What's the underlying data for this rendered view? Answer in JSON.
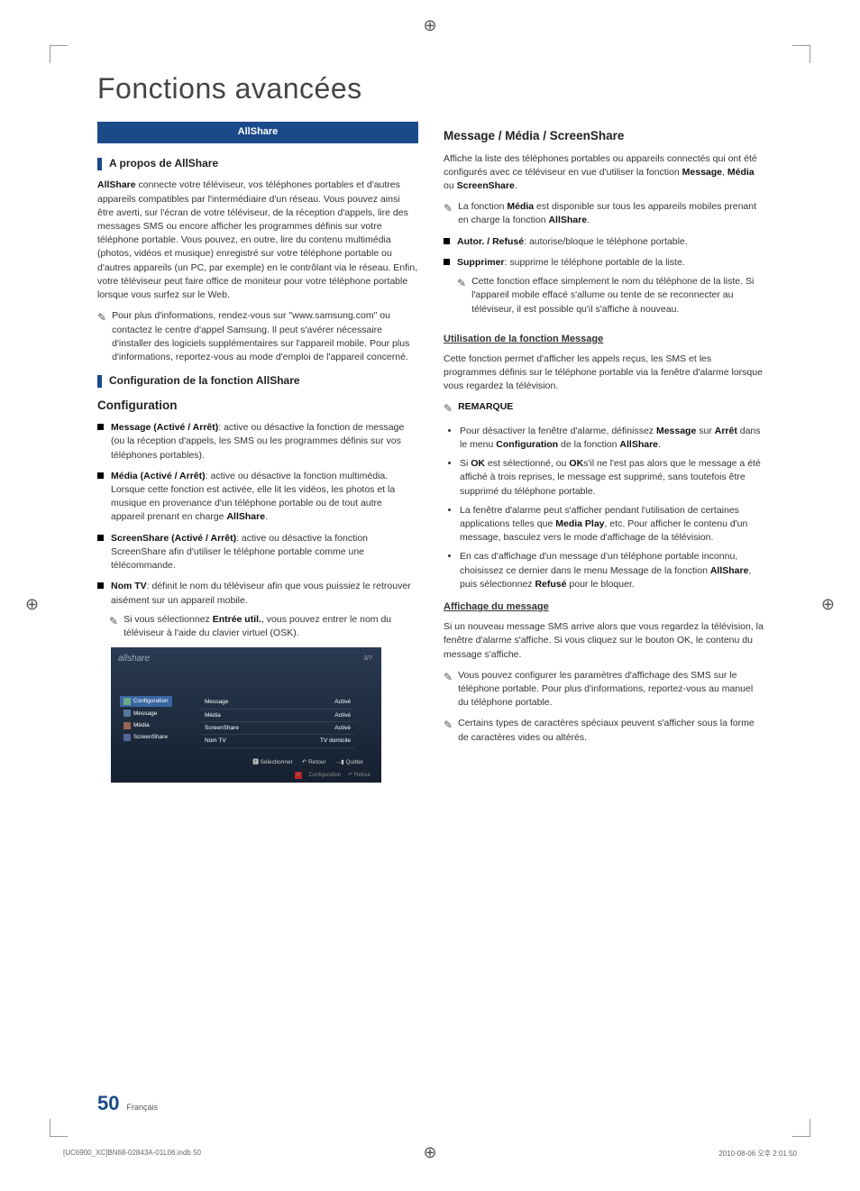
{
  "page_title": "Fonctions avancées",
  "tab_label": "AllShare",
  "left": {
    "section1_title": "A propos de AllShare",
    "para1_a": "AllShare",
    "para1_b": " connecte votre téléviseur, vos téléphones portables et d'autres appareils compatibles par l'intermédiaire d'un réseau. Vous pouvez ainsi être averti, sur l'écran de votre téléviseur, de la réception d'appels, lire des messages SMS ou encore afficher les programmes définis sur votre téléphone portable. Vous pouvez, en outre, lire du contenu multimédia (photos, vidéos et musique) enregistré sur votre téléphone portable ou d'autres appareils (un PC, par exemple) en le contrôlant via le réseau. Enfin, votre téléviseur peut faire office de moniteur pour votre téléphone portable lorsque vous surfez sur le Web.",
    "note1": "Pour plus d'informations, rendez-vous sur \"www.samsung.com\" ou contactez le centre d'appel Samsung. Il peut s'avérer nécessaire d'installer des logiciels supplémentaires sur l'appareil mobile. Pour plus d'informations, reportez-vous au mode d'emploi de l'appareil concerné.",
    "section2_title": "Configuration de la fonction AllShare",
    "config_heading": "Configuration",
    "bullets": [
      {
        "b": "Message (Activé / Arrêt)",
        "t": ": active ou désactive la fonction de message (ou la réception d'appels, les SMS ou les programmes définis sur vos téléphones portables)."
      },
      {
        "b": "Média (Activé / Arrêt)",
        "t": ": active ou désactive la fonction multimédia. Lorsque cette fonction est activée, elle lit les vidéos, les photos et la musique en provenance d'un téléphone portable ou de tout autre appareil prenant en charge ",
        "b2": "AllShare",
        "t2": "."
      },
      {
        "b": "ScreenShare (Activé / Arrêt)",
        "t": ": active ou désactive la fonction ScreenShare afin d'utiliser le téléphone portable comme une télécommande."
      },
      {
        "b": "Nom TV",
        "t": ": définit le nom du téléviseur afin que vous puissiez le retrouver aisément sur un appareil mobile."
      }
    ],
    "nomtv_note_pre": "Si vous sélectionnez ",
    "nomtv_note_b": "Entrée util.",
    "nomtv_note_post": ", vous pouvez entrer le nom du téléviseur à l'aide du clavier virtuel (OSK).",
    "screenshot": {
      "logo": "allshare",
      "badge": "3/7",
      "menu": [
        {
          "label": "Configuration",
          "active": true
        },
        {
          "label": "Message",
          "active": false
        },
        {
          "label": "Média",
          "active": false
        },
        {
          "label": "ScreenShare",
          "active": false
        }
      ],
      "rows": [
        {
          "k": "Message",
          "v": "Activé"
        },
        {
          "k": "Média",
          "v": "Activé"
        },
        {
          "k": "ScreenShare",
          "v": "Activé"
        },
        {
          "k": "Nom TV",
          "v": "TV domicile"
        }
      ],
      "footer": {
        "select": "Sélectionner",
        "return": "Retour",
        "exit": "Quitter"
      },
      "footer2": {
        "a": "Configuration",
        "b": "Retour"
      }
    }
  },
  "right": {
    "heading": "Message / Média / ScreenShare",
    "intro_a": "Affiche la liste des téléphones portables ou appareils connectés qui ont été configurés avec ce téléviseur en vue d'utiliser la fonction ",
    "intro_b1": "Message",
    "intro_sep": ", ",
    "intro_b2": "Média",
    "intro_or": " ou ",
    "intro_b3": "ScreenShare",
    "intro_end": ".",
    "note_media_a": "La fonction ",
    "note_media_b": "Média",
    "note_media_c": " est disponible sur tous les appareils mobiles prenant en charge la fonction ",
    "note_media_d": "AllShare",
    "note_media_e": ".",
    "bullet_autor": {
      "b": "Autor. / Refusé",
      "t": ": autorise/bloque le téléphone portable."
    },
    "bullet_suppr": {
      "b": "Supprimer",
      "t": ": supprime le téléphone portable de la liste."
    },
    "suppr_note": "Cette fonction efface simplement le nom du téléphone de la liste. Si l'appareil mobile effacé s'allume ou tente de se reconnecter au téléviseur, il est possible qu'il s'affiche à nouveau.",
    "msg_heading": "Utilisation de la fonction Message",
    "msg_para": "Cette fonction permet d'afficher les appels reçus, les SMS et les programmes définis sur le téléphone portable via la fenêtre d'alarme lorsque vous regardez la télévision.",
    "remarque_label": "REMARQUE",
    "remarques": [
      {
        "pre": "Pour désactiver la fenêtre d'alarme, définissez ",
        "b1": "Message",
        "mid": " sur ",
        "b2": "Arrêt",
        "mid2": " dans le menu ",
        "b3": "Configuration",
        "mid3": " de la fonction ",
        "b4": "AllShare",
        "end": "."
      },
      {
        "pre": "Si ",
        "b1": "OK",
        "mid": " est sélectionné, ou ",
        "b2": "OK",
        "mid2": "s'il ne l'est pas alors que le message a été affiché à trois reprises, le message est supprimé, sans toutefois être supprimé du téléphone portable."
      },
      {
        "pre": "La fenêtre d'alarme peut s'afficher pendant l'utilisation de certaines applications telles que ",
        "b1": "Media Play",
        "mid": ", etc. Pour afficher le contenu d'un message, basculez vers le mode d'affichage de la télévision."
      },
      {
        "pre": "En cas d'affichage d'un message d'un téléphone portable inconnu, choisissez ce dernier dans le menu Message de la fonction ",
        "b1": "AllShare",
        "mid": ", puis sélectionnez ",
        "b2": "Refusé",
        "mid2": " pour le bloquer."
      }
    ],
    "aff_heading": "Affichage du message",
    "aff_para": "Si un nouveau message SMS arrive alors que vous regardez la télévision, la fenêtre d'alarme s'affiche. Si vous cliquez sur le bouton OK, le contenu du message s'affiche.",
    "aff_note1": "Vous pouvez configurer les paramètres d'affichage des SMS sur le téléphone portable. Pour plus d'informations, reportez-vous au manuel du téléphone portable.",
    "aff_note2": "Certains types de caractères spéciaux peuvent s'afficher sous la forme de caractères vides ou altérés."
  },
  "footer": {
    "pagenum": "50",
    "lang": "Français",
    "file": "[UC6900_XC]BN68-02843A-01L06.indb   50",
    "date": "2010-08-06   오후 2:01:50"
  }
}
